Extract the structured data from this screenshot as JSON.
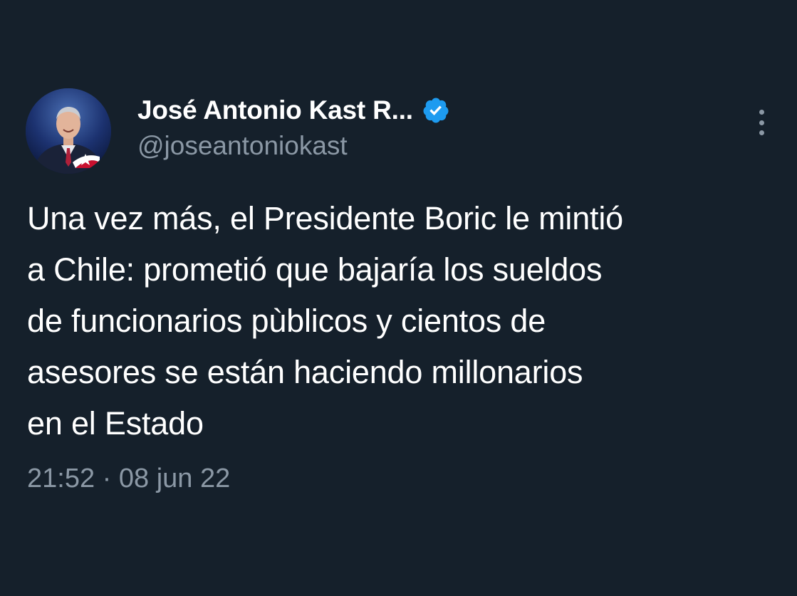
{
  "author": {
    "display_name": "José Antonio Kast R...",
    "handle": "@joseantoniokast",
    "verified": true
  },
  "tweet": {
    "text_lines": [
      "Una vez más, el Presidente Boric le mintió",
      "a Chile: prometió que bajaría los sueldos",
      "de funcionarios pùblicos y cientos de",
      "asesores se están haciendo millonarios",
      "en el Estado"
    ],
    "time": "21:52",
    "separator": "·",
    "date": "08 jun 22"
  },
  "icons": {
    "verified": "verified-badge-icon",
    "more": "more-vertical-icon"
  },
  "colors": {
    "background": "#15202b",
    "text": "#ffffff",
    "secondary_text": "#8b98a5",
    "verified_blue": "#1d9bf0"
  }
}
